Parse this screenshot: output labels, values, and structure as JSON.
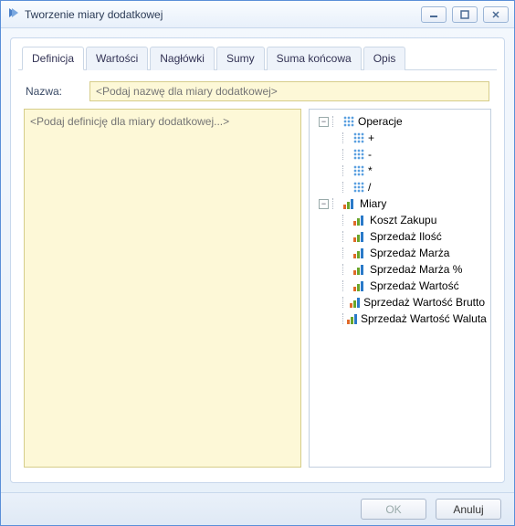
{
  "window": {
    "title": "Tworzenie miary dodatkowej"
  },
  "tabs": {
    "definition": "Definicja",
    "values": "Wartości",
    "headers": "Nagłówki",
    "sums": "Sumy",
    "finalSum": "Suma końcowa",
    "description": "Opis"
  },
  "form": {
    "nameLabel": "Nazwa:",
    "namePlaceholder": "<Podaj nazwę dla miary dodatkowej>",
    "definitionPlaceholder": "<Podaj definicję dla miary dodatkowej...>"
  },
  "tree": {
    "operations": {
      "label": "Operacje",
      "items": [
        "+",
        "-",
        "*",
        "/"
      ]
    },
    "measures": {
      "label": "Miary",
      "items": [
        "Koszt Zakupu",
        "Sprzedaż Ilość",
        "Sprzedaż Marża",
        "Sprzedaż Marża %",
        "Sprzedaż Wartość",
        "Sprzedaż Wartość Brutto",
        "Sprzedaż Wartość Waluta"
      ]
    }
  },
  "buttons": {
    "ok": "OK",
    "cancel": "Anuluj"
  }
}
